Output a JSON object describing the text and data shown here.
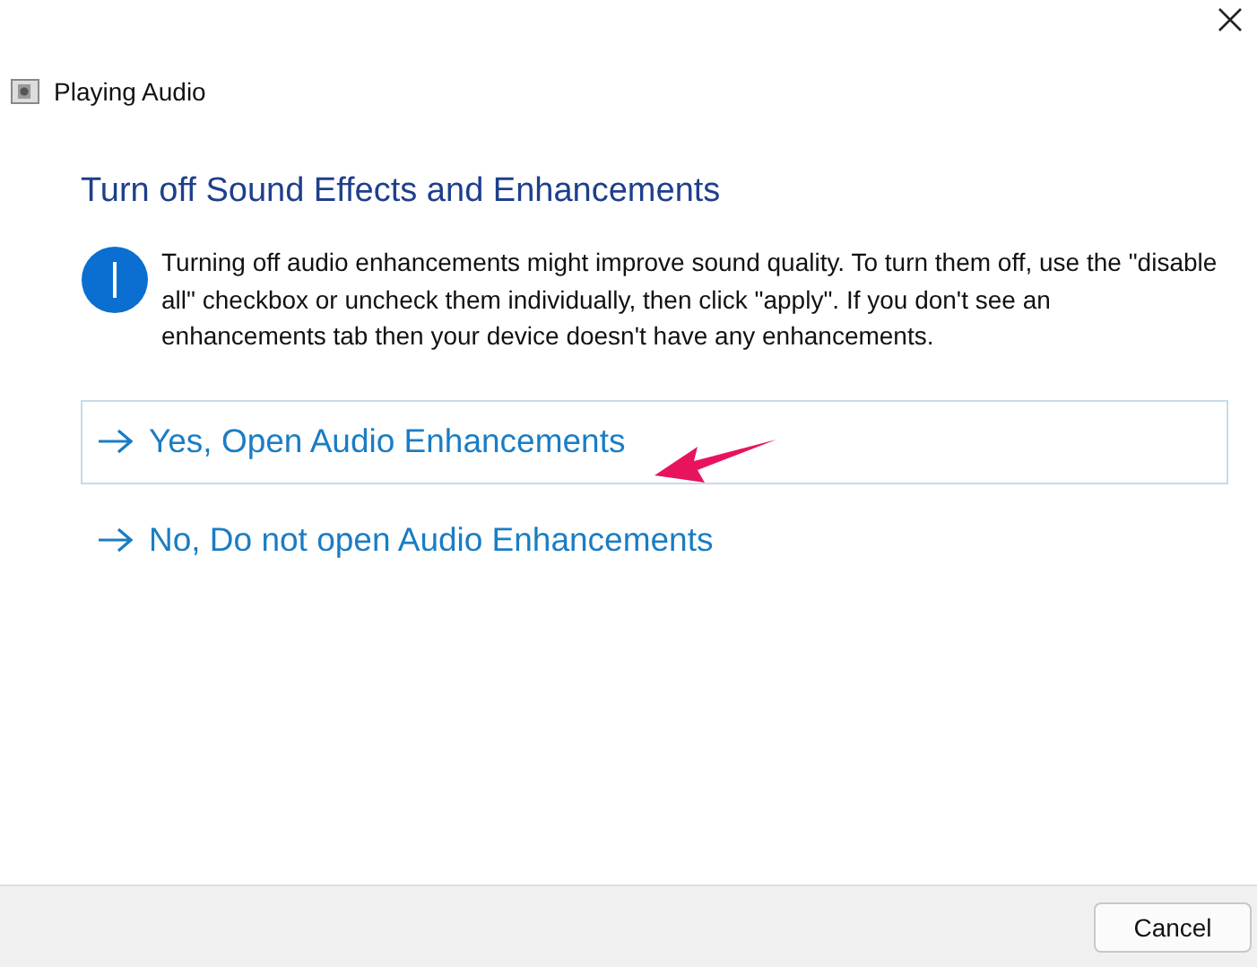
{
  "window": {
    "title": "Playing Audio"
  },
  "heading": "Turn off Sound Effects and Enhancements",
  "message": "Turning off audio enhancements might improve sound quality. To turn them off, use the \"disable all\" checkbox or uncheck them individually, then click \"apply\". If you don't see an enhancements tab then your device doesn't have any enhancements.",
  "options": [
    {
      "label": "Yes, Open Audio Enhancements",
      "selected": true
    },
    {
      "label": "No, Do not open Audio Enhancements",
      "selected": false
    }
  ],
  "buttons": [
    "Cancel"
  ]
}
